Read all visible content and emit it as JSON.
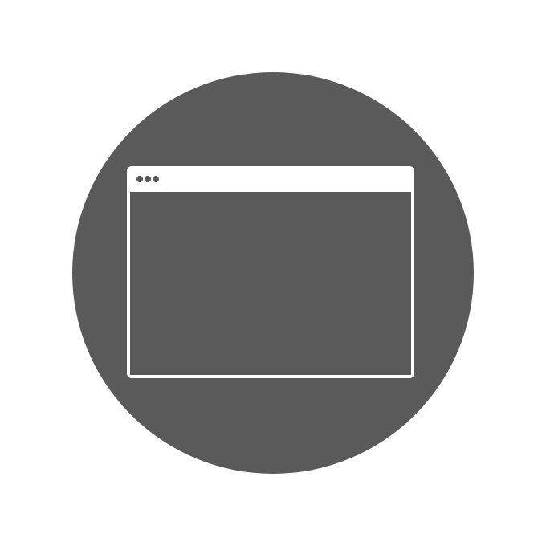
{
  "icon": {
    "name": "browser-window-icon",
    "background_color": "#5a5a5a",
    "window_stroke_color": "#ffffff",
    "dot_color": "#5a5a5a",
    "dots": [
      "dot",
      "dot",
      "dot"
    ]
  }
}
